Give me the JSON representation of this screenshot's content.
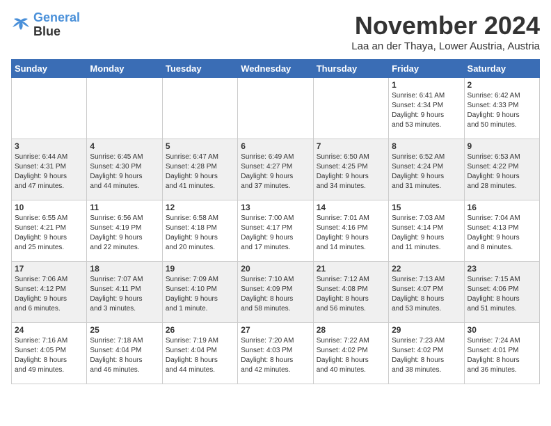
{
  "header": {
    "logo_line1": "General",
    "logo_line2": "Blue",
    "month_title": "November 2024",
    "location": "Laa an der Thaya, Lower Austria, Austria"
  },
  "days_of_week": [
    "Sunday",
    "Monday",
    "Tuesday",
    "Wednesday",
    "Thursday",
    "Friday",
    "Saturday"
  ],
  "weeks": [
    [
      {
        "day": "",
        "info": ""
      },
      {
        "day": "",
        "info": ""
      },
      {
        "day": "",
        "info": ""
      },
      {
        "day": "",
        "info": ""
      },
      {
        "day": "",
        "info": ""
      },
      {
        "day": "1",
        "info": "Sunrise: 6:41 AM\nSunset: 4:34 PM\nDaylight: 9 hours\nand 53 minutes."
      },
      {
        "day": "2",
        "info": "Sunrise: 6:42 AM\nSunset: 4:33 PM\nDaylight: 9 hours\nand 50 minutes."
      }
    ],
    [
      {
        "day": "3",
        "info": "Sunrise: 6:44 AM\nSunset: 4:31 PM\nDaylight: 9 hours\nand 47 minutes."
      },
      {
        "day": "4",
        "info": "Sunrise: 6:45 AM\nSunset: 4:30 PM\nDaylight: 9 hours\nand 44 minutes."
      },
      {
        "day": "5",
        "info": "Sunrise: 6:47 AM\nSunset: 4:28 PM\nDaylight: 9 hours\nand 41 minutes."
      },
      {
        "day": "6",
        "info": "Sunrise: 6:49 AM\nSunset: 4:27 PM\nDaylight: 9 hours\nand 37 minutes."
      },
      {
        "day": "7",
        "info": "Sunrise: 6:50 AM\nSunset: 4:25 PM\nDaylight: 9 hours\nand 34 minutes."
      },
      {
        "day": "8",
        "info": "Sunrise: 6:52 AM\nSunset: 4:24 PM\nDaylight: 9 hours\nand 31 minutes."
      },
      {
        "day": "9",
        "info": "Sunrise: 6:53 AM\nSunset: 4:22 PM\nDaylight: 9 hours\nand 28 minutes."
      }
    ],
    [
      {
        "day": "10",
        "info": "Sunrise: 6:55 AM\nSunset: 4:21 PM\nDaylight: 9 hours\nand 25 minutes."
      },
      {
        "day": "11",
        "info": "Sunrise: 6:56 AM\nSunset: 4:19 PM\nDaylight: 9 hours\nand 22 minutes."
      },
      {
        "day": "12",
        "info": "Sunrise: 6:58 AM\nSunset: 4:18 PM\nDaylight: 9 hours\nand 20 minutes."
      },
      {
        "day": "13",
        "info": "Sunrise: 7:00 AM\nSunset: 4:17 PM\nDaylight: 9 hours\nand 17 minutes."
      },
      {
        "day": "14",
        "info": "Sunrise: 7:01 AM\nSunset: 4:16 PM\nDaylight: 9 hours\nand 14 minutes."
      },
      {
        "day": "15",
        "info": "Sunrise: 7:03 AM\nSunset: 4:14 PM\nDaylight: 9 hours\nand 11 minutes."
      },
      {
        "day": "16",
        "info": "Sunrise: 7:04 AM\nSunset: 4:13 PM\nDaylight: 9 hours\nand 8 minutes."
      }
    ],
    [
      {
        "day": "17",
        "info": "Sunrise: 7:06 AM\nSunset: 4:12 PM\nDaylight: 9 hours\nand 6 minutes."
      },
      {
        "day": "18",
        "info": "Sunrise: 7:07 AM\nSunset: 4:11 PM\nDaylight: 9 hours\nand 3 minutes."
      },
      {
        "day": "19",
        "info": "Sunrise: 7:09 AM\nSunset: 4:10 PM\nDaylight: 9 hours\nand 1 minute."
      },
      {
        "day": "20",
        "info": "Sunrise: 7:10 AM\nSunset: 4:09 PM\nDaylight: 8 hours\nand 58 minutes."
      },
      {
        "day": "21",
        "info": "Sunrise: 7:12 AM\nSunset: 4:08 PM\nDaylight: 8 hours\nand 56 minutes."
      },
      {
        "day": "22",
        "info": "Sunrise: 7:13 AM\nSunset: 4:07 PM\nDaylight: 8 hours\nand 53 minutes."
      },
      {
        "day": "23",
        "info": "Sunrise: 7:15 AM\nSunset: 4:06 PM\nDaylight: 8 hours\nand 51 minutes."
      }
    ],
    [
      {
        "day": "24",
        "info": "Sunrise: 7:16 AM\nSunset: 4:05 PM\nDaylight: 8 hours\nand 49 minutes."
      },
      {
        "day": "25",
        "info": "Sunrise: 7:18 AM\nSunset: 4:04 PM\nDaylight: 8 hours\nand 46 minutes."
      },
      {
        "day": "26",
        "info": "Sunrise: 7:19 AM\nSunset: 4:04 PM\nDaylight: 8 hours\nand 44 minutes."
      },
      {
        "day": "27",
        "info": "Sunrise: 7:20 AM\nSunset: 4:03 PM\nDaylight: 8 hours\nand 42 minutes."
      },
      {
        "day": "28",
        "info": "Sunrise: 7:22 AM\nSunset: 4:02 PM\nDaylight: 8 hours\nand 40 minutes."
      },
      {
        "day": "29",
        "info": "Sunrise: 7:23 AM\nSunset: 4:02 PM\nDaylight: 8 hours\nand 38 minutes."
      },
      {
        "day": "30",
        "info": "Sunrise: 7:24 AM\nSunset: 4:01 PM\nDaylight: 8 hours\nand 36 minutes."
      }
    ]
  ]
}
